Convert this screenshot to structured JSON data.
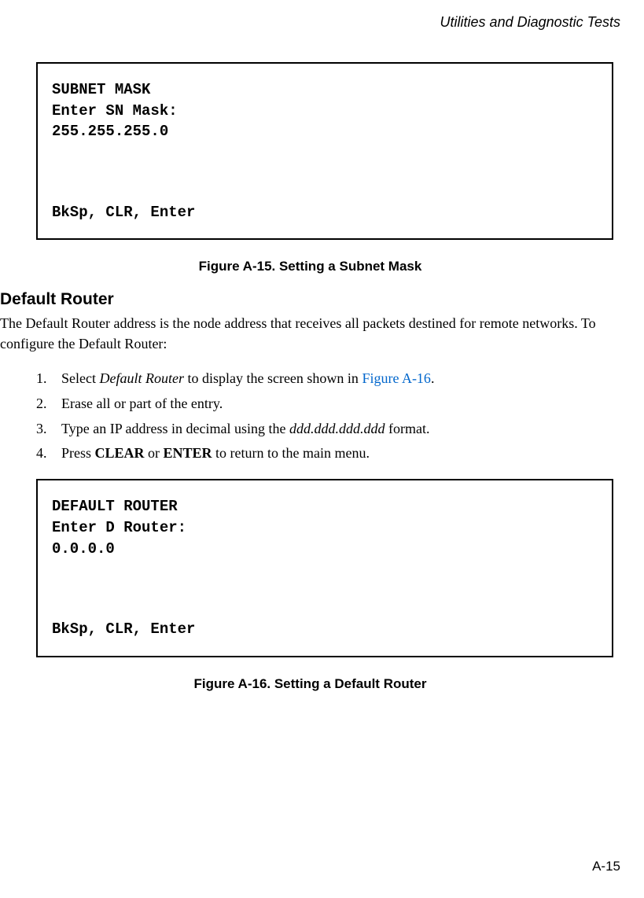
{
  "header": {
    "running_title": "Utilities and Diagnostic Tests"
  },
  "screen1": {
    "line1": "SUBNET MASK",
    "line2": "Enter SN Mask:",
    "line3": "255.255.255.0",
    "line4": "BkSp, CLR, Enter"
  },
  "figure1_caption": "Figure A-15.  Setting a Subnet Mask",
  "section_heading": "Default Router",
  "para1": "The Default Router address is the node address that receives all packets destined for remote networks. To configure the Default Router:",
  "steps": {
    "s1_a": "Select ",
    "s1_italic": "Default Router",
    "s1_b": " to display the screen shown in ",
    "s1_link": "Figure A-16",
    "s1_c": ".",
    "s2": "Erase all or part of the entry.",
    "s3_a": "Type an IP address in decimal using the ",
    "s3_italic": "ddd.ddd.ddd.ddd",
    "s3_b": " format.",
    "s4_a": "Press ",
    "s4_bold1": "CLEAR",
    "s4_b": " or ",
    "s4_bold2": "ENTER",
    "s4_c": " to return to the main menu."
  },
  "screen2": {
    "line1": "DEFAULT ROUTER",
    "line2": "Enter D Router:",
    "line3": "0.0.0.0",
    "line4": "BkSp, CLR, Enter"
  },
  "figure2_caption": "Figure A-16.  Setting a Default Router",
  "footer": {
    "page_number": "A-15"
  }
}
